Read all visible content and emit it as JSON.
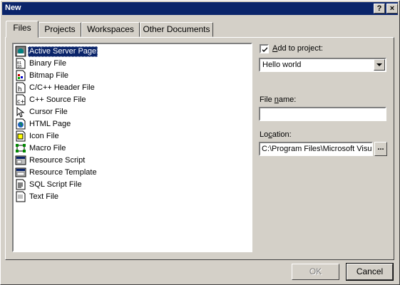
{
  "dialog": {
    "title": "New",
    "help_glyph": "?",
    "close_glyph": "×"
  },
  "tabs": [
    {
      "label": "Files",
      "active": true
    },
    {
      "label": "Projects",
      "active": false
    },
    {
      "label": "Workspaces",
      "active": false
    },
    {
      "label": "Other Documents",
      "active": false
    }
  ],
  "file_types": [
    {
      "label": "Active Server Page",
      "icon": "asp-icon",
      "selected": true
    },
    {
      "label": "Binary File",
      "icon": "binary-file-icon",
      "selected": false
    },
    {
      "label": "Bitmap File",
      "icon": "bitmap-file-icon",
      "selected": false
    },
    {
      "label": "C/C++ Header File",
      "icon": "header-file-icon",
      "selected": false
    },
    {
      "label": "C++ Source File",
      "icon": "source-file-icon",
      "selected": false
    },
    {
      "label": "Cursor File",
      "icon": "cursor-file-icon",
      "selected": false
    },
    {
      "label": "HTML Page",
      "icon": "html-page-icon",
      "selected": false
    },
    {
      "label": "Icon File",
      "icon": "icon-file-icon",
      "selected": false
    },
    {
      "label": "Macro File",
      "icon": "macro-file-icon",
      "selected": false
    },
    {
      "label": "Resource Script",
      "icon": "resource-script-icon",
      "selected": false
    },
    {
      "label": "Resource Template",
      "icon": "resource-template-icon",
      "selected": false
    },
    {
      "label": "SQL Script File",
      "icon": "sql-script-icon",
      "selected": false
    },
    {
      "label": "Text File",
      "icon": "text-file-icon",
      "selected": false
    }
  ],
  "add_to_project": {
    "label_prefix": "",
    "label_accel": "A",
    "label_rest": "dd to project:",
    "checked": true,
    "selected_project": "Hello world"
  },
  "file_name": {
    "label_prefix": "File ",
    "label_accel": "n",
    "label_rest": "ame:",
    "value": ""
  },
  "location": {
    "label_prefix": "Lo",
    "label_accel": "c",
    "label_rest": "ation:",
    "value": "C:\\Program Files\\Microsoft Visual Studio",
    "browse_label": "..."
  },
  "buttons": {
    "ok": "OK",
    "cancel": "Cancel"
  },
  "colors": {
    "titlebar": "#0a246a",
    "face": "#d4d0c8",
    "selection": "#0a246a"
  }
}
